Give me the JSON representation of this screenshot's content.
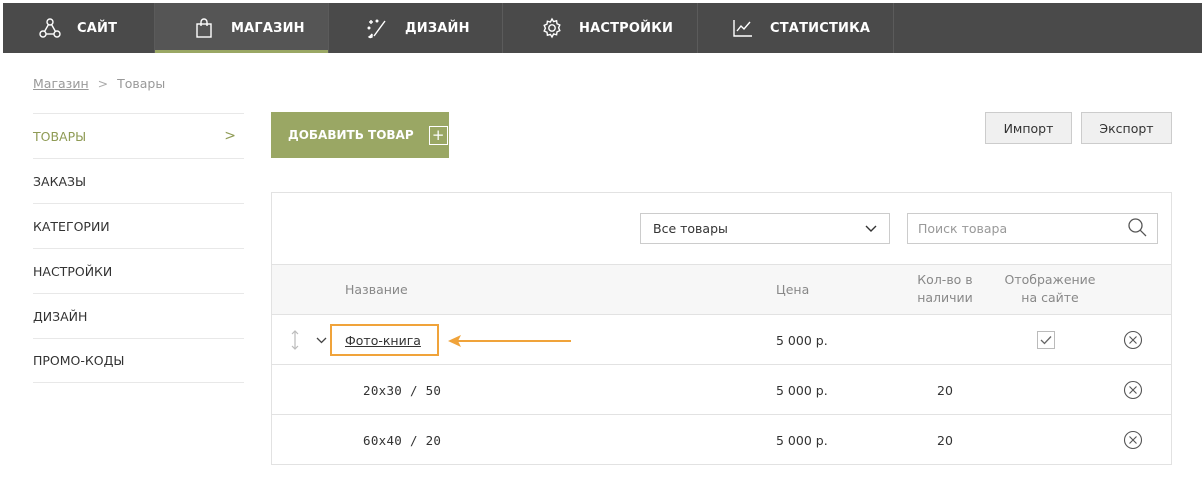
{
  "nav": {
    "site": "САЙТ",
    "shop": "МАГАЗИН",
    "design": "ДИЗАЙН",
    "settings": "НАСТРОЙКИ",
    "stats": "СТАТИСТИКА"
  },
  "breadcrumb": {
    "parent": "Магазин",
    "separator": ">",
    "current": "Товары"
  },
  "sidebar": {
    "items": [
      {
        "label": "ТОВАРЫ"
      },
      {
        "label": "ЗАКАЗЫ"
      },
      {
        "label": "КАТЕГОРИИ"
      },
      {
        "label": "НАСТРОЙКИ"
      },
      {
        "label": "ДИЗАЙН"
      },
      {
        "label": "ПРОМО-КОДЫ"
      }
    ],
    "active_chevron": ">"
  },
  "toolbar": {
    "add_label": "ДОБАВИТЬ ТОВАР",
    "add_icon": "+",
    "import_label": "Импорт",
    "export_label": "Экспорт"
  },
  "filter": {
    "selected": "Все товары",
    "search_placeholder": "Поиск товара"
  },
  "table": {
    "headers": {
      "name": "Название",
      "price": "Цена",
      "qty_line1": "Кол-во в",
      "qty_line2": "наличии",
      "show_line1": "Отображение",
      "show_line2": "на сайте"
    },
    "product": {
      "name": "Фото-книга",
      "price": "5 000 р.",
      "shown": true
    },
    "variants": [
      {
        "name": "20x30 / 50",
        "price": "5 000 р.",
        "qty": "20"
      },
      {
        "name": "60x40 / 20",
        "price": "5 000 р.",
        "qty": "20"
      }
    ]
  },
  "colors": {
    "accent": "#9aa764",
    "nav_bg": "#4a4a4a",
    "highlight": "#f0a33a"
  }
}
